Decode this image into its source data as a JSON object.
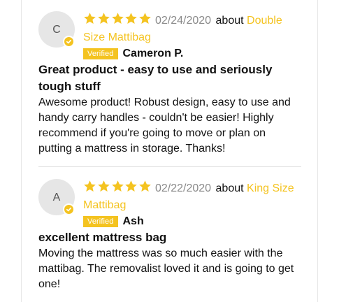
{
  "colors": {
    "accent": "#f4c320",
    "date": "#8a8a8a",
    "avatar_bg": "#e6e6e6"
  },
  "reviews": [
    {
      "avatar_letter": "C",
      "rating": 5,
      "date": "02/24/2020",
      "about_label": "about",
      "product": "Double Size Mattibag",
      "verified_label": "Verified",
      "author": "Cameron P.",
      "title": "Great product - easy to use and seriously tough stuff",
      "body": "Awesome product! Robust design, easy to use and handy carry handles - couldn't be easier! Highly recommend if you're going to move or plan on putting a mattress in storage. Thanks!"
    },
    {
      "avatar_letter": "A",
      "rating": 5,
      "date": "02/22/2020",
      "about_label": "about",
      "product": "King Size Mattibag",
      "verified_label": "Verified",
      "author": "Ash",
      "title": "excellent mattress bag",
      "body": "Moving the mattress was so much easier with the mattibag. The removalist loved it and is going to get one!"
    }
  ]
}
